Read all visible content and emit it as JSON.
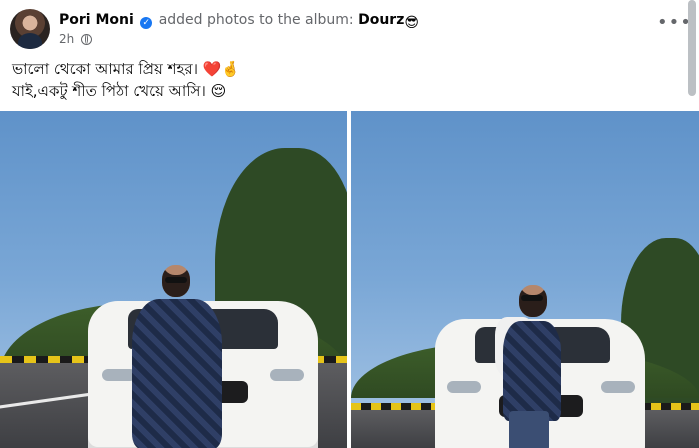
{
  "post": {
    "author": "Pori Moni",
    "verified_glyph": "✓",
    "action": "added photos to the album:",
    "album": "Dourz",
    "album_emoji": "😎",
    "time": "2h",
    "privacy_icon": "globe-icon",
    "more_label": "•••",
    "caption_line1": "ভালো থেকো আমার প্রিয় শহর। ",
    "caption_line1_emoji": "❤️🤞",
    "caption_line2": "যাই,একটু শীত পিঠা খেয়ে আসি। ",
    "caption_line2_emoji": "😌"
  },
  "photos": [
    {
      "name": "photo-1"
    },
    {
      "name": "photo-2"
    }
  ],
  "colors": {
    "verified": "#1877f2",
    "secondary_text": "#65676b",
    "primary_text": "#050505"
  }
}
